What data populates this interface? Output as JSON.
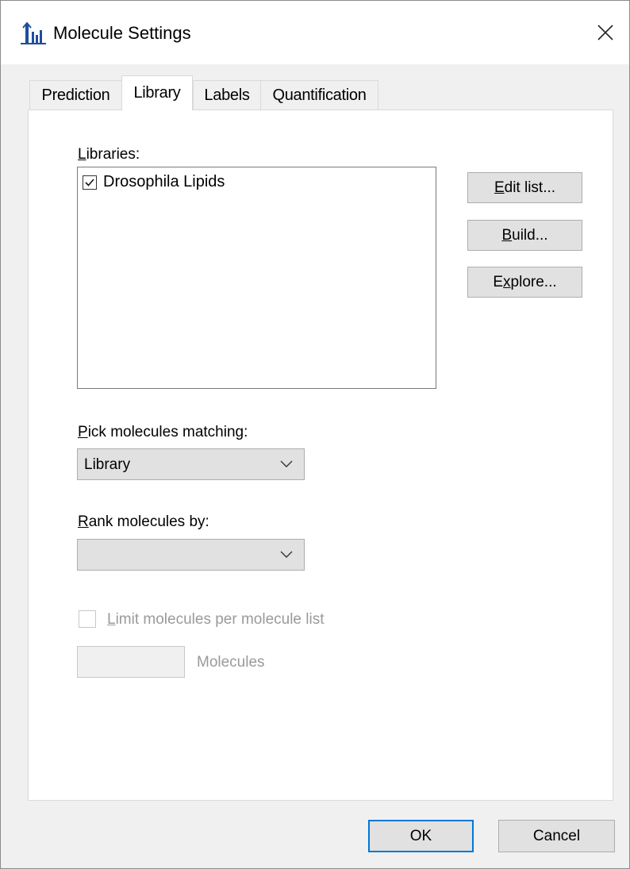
{
  "window": {
    "title": "Molecule Settings",
    "app_icon": "peak-chart-icon",
    "close_icon": "close-icon"
  },
  "tabs": [
    {
      "label": "Prediction",
      "active": false
    },
    {
      "label": "Library",
      "active": true
    },
    {
      "label": "Labels",
      "active": false
    },
    {
      "label": "Quantification",
      "active": false
    }
  ],
  "libraries": {
    "label_mnemonic": "L",
    "label_rest": "ibraries:",
    "items": [
      {
        "name": "Drosophila Lipids",
        "checked": true
      }
    ]
  },
  "side_buttons": {
    "edit_mnemonic": "E",
    "edit_rest": "dit list...",
    "build_mnemonic": "B",
    "build_rest": "uild...",
    "explore_pre": "E",
    "explore_mnemonic": "x",
    "explore_rest": "plore..."
  },
  "pick": {
    "label_mnemonic": "P",
    "label_rest": "ick molecules matching:",
    "value": "Library"
  },
  "rank": {
    "label_mnemonic": "R",
    "label_rest": "ank molecules by:",
    "value": ""
  },
  "limit": {
    "checked": false,
    "label_mnemonic": "L",
    "label_rest": "imit molecules per molecule list",
    "input_value": "",
    "unit": "Molecules"
  },
  "footer": {
    "ok_label": "OK",
    "cancel_label": "Cancel"
  },
  "colors": {
    "accent": "#0078d7",
    "icon_blue": "#1f4e9b"
  }
}
